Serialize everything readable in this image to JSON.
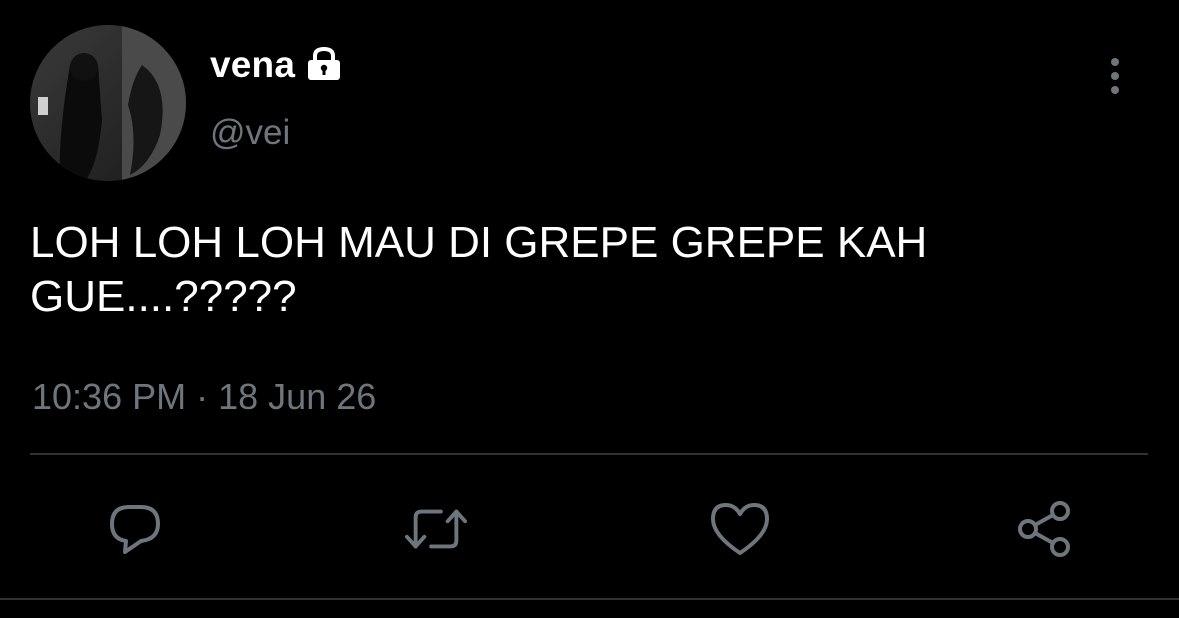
{
  "tweet": {
    "display_name": "vena",
    "handle": "@vei",
    "text": "LOH LOH LOH MAU DI GREPE GREPE KAH GUE....?????",
    "time": "10:36 PM",
    "separator": "·",
    "date": "18 Jun 26"
  },
  "icons": {
    "lock": "lock-icon",
    "more": "more-vertical-icon",
    "reply": "reply-icon",
    "retweet": "retweet-icon",
    "like": "heart-icon",
    "share": "share-icon"
  },
  "colors": {
    "background": "#000000",
    "primary_text": "#ffffff",
    "secondary_text": "#6e767d",
    "divider": "#2f3336",
    "icon": "#6e767d"
  }
}
